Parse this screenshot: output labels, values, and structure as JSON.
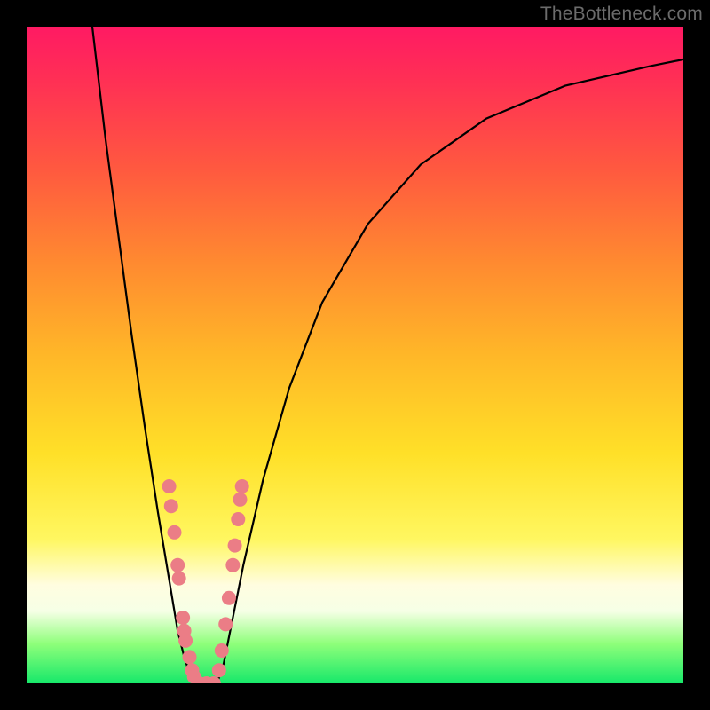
{
  "watermark": "TheBottleneck.com",
  "chart_data": {
    "type": "line",
    "title": "",
    "xlabel": "",
    "ylabel": "",
    "xlim": [
      0,
      100
    ],
    "ylim": [
      0,
      100
    ],
    "grid": false,
    "legend": false,
    "gradient_stops": [
      {
        "pos": 0,
        "color": "#ff1a63"
      },
      {
        "pos": 0.22,
        "color": "#ff5a3f"
      },
      {
        "pos": 0.5,
        "color": "#ffb728"
      },
      {
        "pos": 0.78,
        "color": "#fff760"
      },
      {
        "pos": 0.88,
        "color": "#fcffe8"
      },
      {
        "pos": 1.0,
        "color": "#17e86a"
      }
    ],
    "series": [
      {
        "name": "left-curve",
        "stroke": "#000000",
        "x": [
          10,
          12,
          14,
          16,
          18,
          20,
          22,
          23,
          24,
          25,
          25.7
        ],
        "y": [
          100,
          83,
          68,
          53,
          39,
          26,
          14,
          8,
          4,
          1,
          0
        ]
      },
      {
        "name": "right-curve",
        "stroke": "#000000",
        "x": [
          29,
          30,
          31,
          33,
          36,
          40,
          45,
          52,
          60,
          70,
          82,
          95,
          100
        ],
        "y": [
          0,
          3,
          8,
          18,
          31,
          45,
          58,
          70,
          79,
          86,
          91,
          94,
          95
        ]
      },
      {
        "name": "valley-floor",
        "stroke": "#000000",
        "x": [
          25.7,
          27.3,
          29
        ],
        "y": [
          0,
          -0.3,
          0
        ]
      }
    ],
    "markers": {
      "name": "highlighted-points",
      "color": "#eb7d86",
      "radius_px": 8,
      "points": [
        {
          "x": 21.7,
          "y": 30
        },
        {
          "x": 22.0,
          "y": 27
        },
        {
          "x": 22.5,
          "y": 23
        },
        {
          "x": 23.0,
          "y": 18
        },
        {
          "x": 23.2,
          "y": 16
        },
        {
          "x": 23.8,
          "y": 10
        },
        {
          "x": 24.0,
          "y": 8
        },
        {
          "x": 24.2,
          "y": 6.5
        },
        {
          "x": 24.8,
          "y": 4
        },
        {
          "x": 25.2,
          "y": 2
        },
        {
          "x": 25.5,
          "y": 1
        },
        {
          "x": 26.3,
          "y": 0
        },
        {
          "x": 27.4,
          "y": 0
        },
        {
          "x": 28.5,
          "y": 0
        },
        {
          "x": 29.3,
          "y": 2
        },
        {
          "x": 29.7,
          "y": 5
        },
        {
          "x": 30.3,
          "y": 9
        },
        {
          "x": 30.8,
          "y": 13
        },
        {
          "x": 31.4,
          "y": 18
        },
        {
          "x": 31.7,
          "y": 21
        },
        {
          "x": 32.2,
          "y": 25
        },
        {
          "x": 32.5,
          "y": 28
        },
        {
          "x": 32.8,
          "y": 30
        }
      ]
    }
  }
}
